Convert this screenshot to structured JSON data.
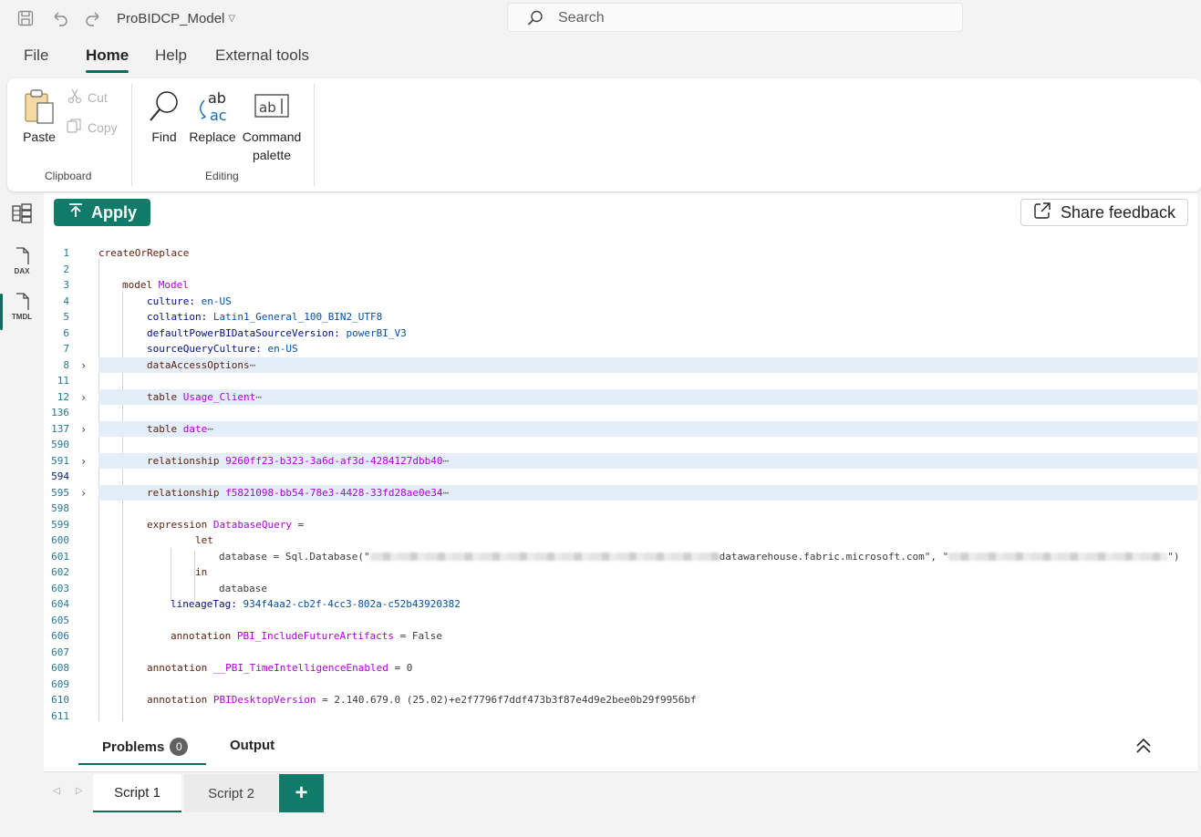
{
  "titlebar": {
    "document_name": "ProBIDCP_Model",
    "search_placeholder": "Search"
  },
  "menu": {
    "tabs": [
      "File",
      "Home",
      "Help",
      "External tools"
    ],
    "active": "Home"
  },
  "ribbon": {
    "clipboard": {
      "paste": "Paste",
      "cut": "Cut",
      "copy": "Copy",
      "group": "Clipboard"
    },
    "editing": {
      "find": "Find",
      "replace": "Replace",
      "command_palette_1": "Command",
      "command_palette_2": "palette",
      "group": "Editing"
    }
  },
  "rail": {
    "dax_label": "DAX",
    "tmdl_label": "TMDL"
  },
  "toolbar": {
    "apply": "Apply",
    "share_feedback": "Share feedback"
  },
  "code": {
    "lines": [
      {
        "n": "1",
        "t": "createOrReplace"
      },
      {
        "n": "2",
        "t": ""
      },
      {
        "n": "3",
        "k": "model",
        "v": "Model"
      },
      {
        "n": "4",
        "p": "culture:",
        "v": "en-US"
      },
      {
        "n": "5",
        "p": "collation:",
        "v": "Latin1_General_100_BIN2_UTF8"
      },
      {
        "n": "6",
        "p": "defaultPowerBIDataSourceVersion:",
        "v": "powerBI_V3"
      },
      {
        "n": "7",
        "p": "sourceQueryCulture:",
        "v": "en-US"
      },
      {
        "n": "8",
        "k": "dataAccessOptions"
      },
      {
        "n": "11",
        "t": ""
      },
      {
        "n": "12",
        "k": "table",
        "v": "Usage_Client"
      },
      {
        "n": "136",
        "t": ""
      },
      {
        "n": "137",
        "k": "table",
        "v": "date"
      },
      {
        "n": "590",
        "t": ""
      },
      {
        "n": "591",
        "k": "relationship",
        "v": "9260ff23-b323-3a6d-af3d-4284127dbb40"
      },
      {
        "n": "594",
        "t": ""
      },
      {
        "n": "595",
        "k": "relationship",
        "v": "f5821098-bb54-78e3-4428-33fd28ae0e34"
      },
      {
        "n": "598",
        "t": ""
      },
      {
        "n": "599",
        "k": "expression",
        "v": "DatabaseQuery",
        "s": "="
      },
      {
        "n": "600",
        "t": "let"
      },
      {
        "n": "601",
        "a": "database = Sql.Database(\"",
        "b": "datawarehouse.fabric.microsoft.com\", \"",
        "c": "\")"
      },
      {
        "n": "602",
        "t": "in"
      },
      {
        "n": "603",
        "t": "database"
      },
      {
        "n": "604",
        "p": "lineageTag:",
        "v": "934f4aa2-cb2f-4cc3-802a-c52b43920382"
      },
      {
        "n": "605",
        "t": ""
      },
      {
        "n": "606",
        "k": "annotation",
        "v": "PBI_IncludeFutureArtifacts",
        "s": "= False"
      },
      {
        "n": "607",
        "t": ""
      },
      {
        "n": "608",
        "k": "annotation",
        "v": "__PBI_TimeIntelligenceEnabled",
        "s": "= 0"
      },
      {
        "n": "609",
        "t": ""
      },
      {
        "n": "610",
        "k": "annotation",
        "v": "PBIDesktopVersion",
        "s": "= 2.140.679.0 (25.02)+e2f7796f7ddf473b3f87e4d9e2bee0b29f9956bf"
      },
      {
        "n": "611",
        "t": ""
      }
    ],
    "ellipsis": "⋯"
  },
  "panel": {
    "problems": "Problems",
    "problems_count": "0",
    "output": "Output"
  },
  "scripts": {
    "tabs": [
      "Script 1",
      "Script 2"
    ],
    "add": "+"
  },
  "colors": {
    "accent": "#0f7b68",
    "highlight": "#e3eef8"
  }
}
